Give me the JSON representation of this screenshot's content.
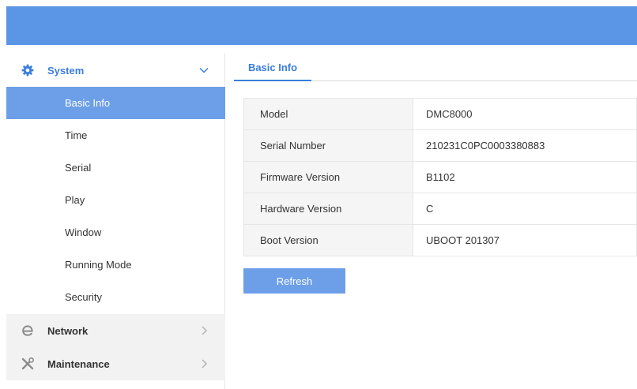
{
  "sidebar": {
    "system": {
      "label": "System",
      "icon": "gear-icon",
      "expanded": true
    },
    "items": [
      {
        "label": "Basic Info",
        "active": true
      },
      {
        "label": "Time"
      },
      {
        "label": "Serial"
      },
      {
        "label": "Play"
      },
      {
        "label": "Window"
      },
      {
        "label": "Running Mode"
      },
      {
        "label": "Security"
      }
    ],
    "network": {
      "label": "Network",
      "icon": "network-e-icon"
    },
    "maintenance": {
      "label": "Maintenance",
      "icon": "tools-icon"
    }
  },
  "tabs": [
    {
      "label": "Basic Info",
      "active": true
    }
  ],
  "info": {
    "rows": [
      {
        "key": "Model",
        "value": "DMC8000"
      },
      {
        "key": "Serial Number",
        "value": "210231C0PC0003380883"
      },
      {
        "key": "Firmware Version",
        "value": "B1102"
      },
      {
        "key": "Hardware Version",
        "value": "C"
      },
      {
        "key": "Boot Version",
        "value": "UBOOT 201307"
      }
    ]
  },
  "actions": {
    "refresh_label": "Refresh"
  },
  "colors": {
    "header": "#5b95e5",
    "accent": "#3b7ddd",
    "active_item": "#6c9fe8",
    "button": "#6c9fe8"
  }
}
